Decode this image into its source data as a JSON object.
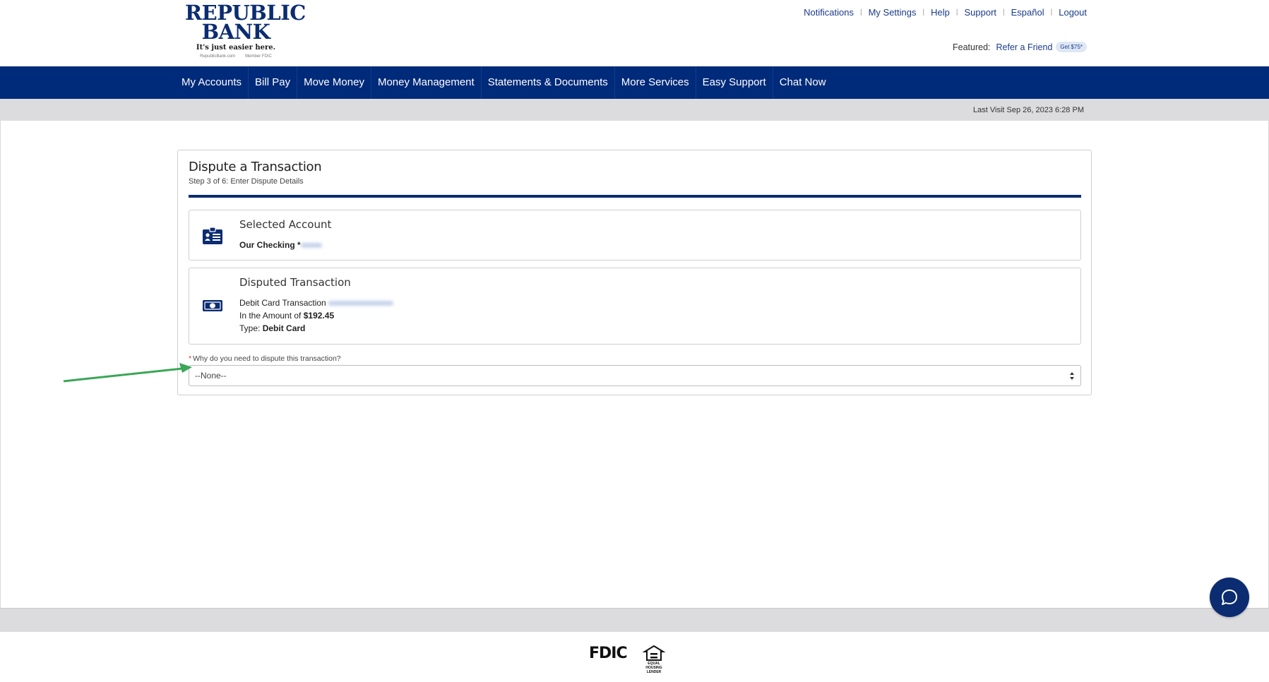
{
  "logo": {
    "line1": "REPUBLIC",
    "line2": "BANK",
    "tagline": "It's just easier here.",
    "small_left": "RepublicBank.com",
    "small_right": "Member FDIC"
  },
  "top_links": [
    "Notifications",
    "My Settings",
    "Help",
    "Support",
    "Español",
    "Logout"
  ],
  "featured": {
    "label": "Featured:",
    "link": "Refer a Friend",
    "badge": "Get $75*"
  },
  "nav": [
    "My Accounts",
    "Bill Pay",
    "Move Money",
    "Money Management",
    "Statements & Documents",
    "More Services",
    "Easy Support",
    "Chat Now"
  ],
  "last_visit": "Last Visit Sep 26, 2023 6:28 PM",
  "dispute": {
    "title": "Dispute a Transaction",
    "step": "Step 3 of 6: Enter Dispute Details",
    "account": {
      "heading": "Selected Account",
      "name": "Our Checking *"
    },
    "transaction": {
      "heading": "Disputed Transaction",
      "desc_label": "Debit Card Transaction",
      "amount_prefix": "In the Amount of",
      "amount": "$192.45",
      "type_prefix": "Type:",
      "type": "Debit Card"
    },
    "reason": {
      "label": "Why do you need to dispute this transaction?",
      "required_mark": "*",
      "selected": "--None--"
    }
  },
  "footer": {
    "fdic": "FDIC",
    "ehl": "EQUAL HOUSING LENDER"
  },
  "colors": {
    "brand_navy": "#002a7a",
    "annotation_arrow": "#3aa657"
  },
  "icons": {
    "account": "id-card-icon",
    "transaction": "cash-icon",
    "select": "select-arrows-icon",
    "chat": "chat-bubble-icon",
    "housing": "equal-housing-icon"
  }
}
